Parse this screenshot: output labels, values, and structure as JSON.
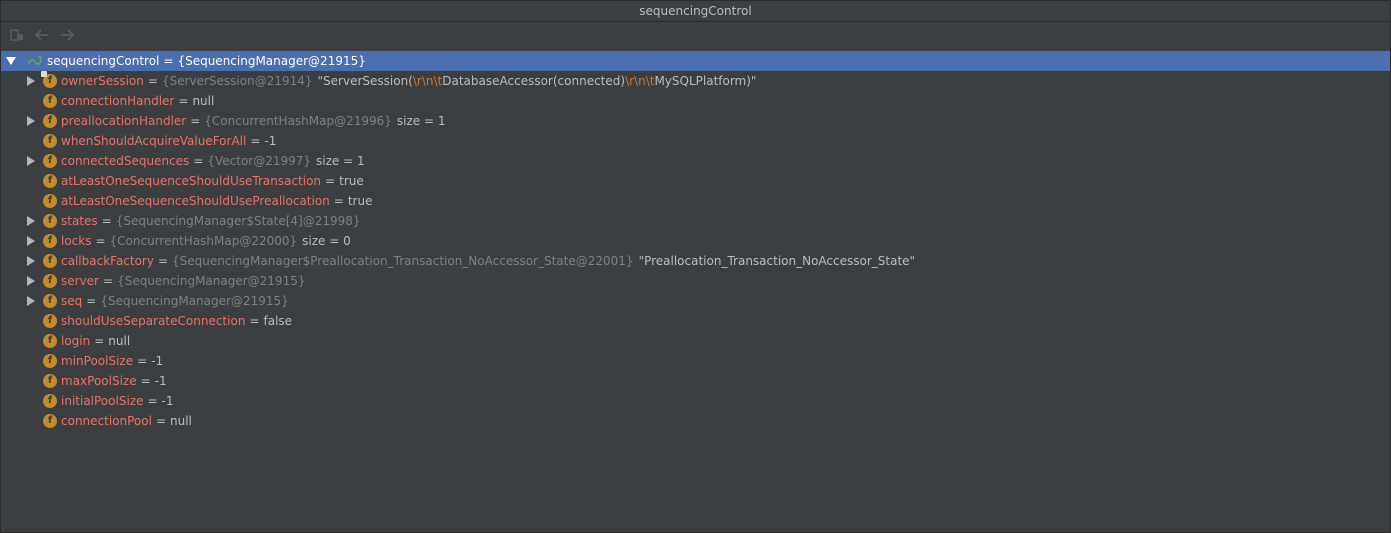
{
  "window": {
    "title": "sequencingControl"
  },
  "toolbar": {
    "buttons": [
      {
        "name": "restore-layout"
      },
      {
        "name": "back"
      },
      {
        "name": "forward"
      }
    ]
  },
  "root": {
    "name": "sequencingControl",
    "eq": "=",
    "type": "{SequencingManager@21915}"
  },
  "fields": [
    {
      "name": "ownerSession",
      "type": "{ServerSession@21914}",
      "str_parts": [
        "\"ServerSession(",
        "\\r\\n\\t",
        "DatabaseAccessor(connected)",
        "\\r\\n\\t",
        "MySQLPlatform)\""
      ],
      "expandable": true,
      "locked": true
    },
    {
      "name": "connectionHandler",
      "value": "null",
      "expandable": false
    },
    {
      "name": "preallocationHandler",
      "type": "{ConcurrentHashMap@21996}",
      "size": "size = 1",
      "expandable": true
    },
    {
      "name": "whenShouldAcquireValueForAll",
      "value": "-1",
      "expandable": false
    },
    {
      "name": "connectedSequences",
      "type": "{Vector@21997}",
      "size": "size = 1",
      "expandable": true
    },
    {
      "name": "atLeastOneSequenceShouldUseTransaction",
      "value": "true",
      "expandable": false
    },
    {
      "name": "atLeastOneSequenceShouldUsePreallocation",
      "value": "true",
      "expandable": false
    },
    {
      "name": "states",
      "type": "{SequencingManager$State[4]@21998}",
      "expandable": true
    },
    {
      "name": "locks",
      "type": "{ConcurrentHashMap@22000}",
      "size": "size = 0",
      "expandable": true
    },
    {
      "name": "callbackFactory",
      "type": "{SequencingManager$Preallocation_Transaction_NoAccessor_State@22001}",
      "str": "\"Preallocation_Transaction_NoAccessor_State\"",
      "expandable": true
    },
    {
      "name": "server",
      "type": "{SequencingManager@21915}",
      "expandable": true
    },
    {
      "name": "seq",
      "type": "{SequencingManager@21915}",
      "expandable": true
    },
    {
      "name": "shouldUseSeparateConnection",
      "value": "false",
      "expandable": false
    },
    {
      "name": "login",
      "value": "null",
      "expandable": false
    },
    {
      "name": "minPoolSize",
      "value": "-1",
      "expandable": false
    },
    {
      "name": "maxPoolSize",
      "value": "-1",
      "expandable": false
    },
    {
      "name": "initialPoolSize",
      "value": "-1",
      "expandable": false
    },
    {
      "name": "connectionPool",
      "value": "null",
      "expandable": false
    }
  ],
  "icons": {
    "field_letter": "f"
  },
  "colors": {
    "selection": "#4b6eaf",
    "field_name": "#e8736b",
    "type_ref": "#808080",
    "escape": "#cc7832",
    "field_icon": "#c78c2a"
  }
}
